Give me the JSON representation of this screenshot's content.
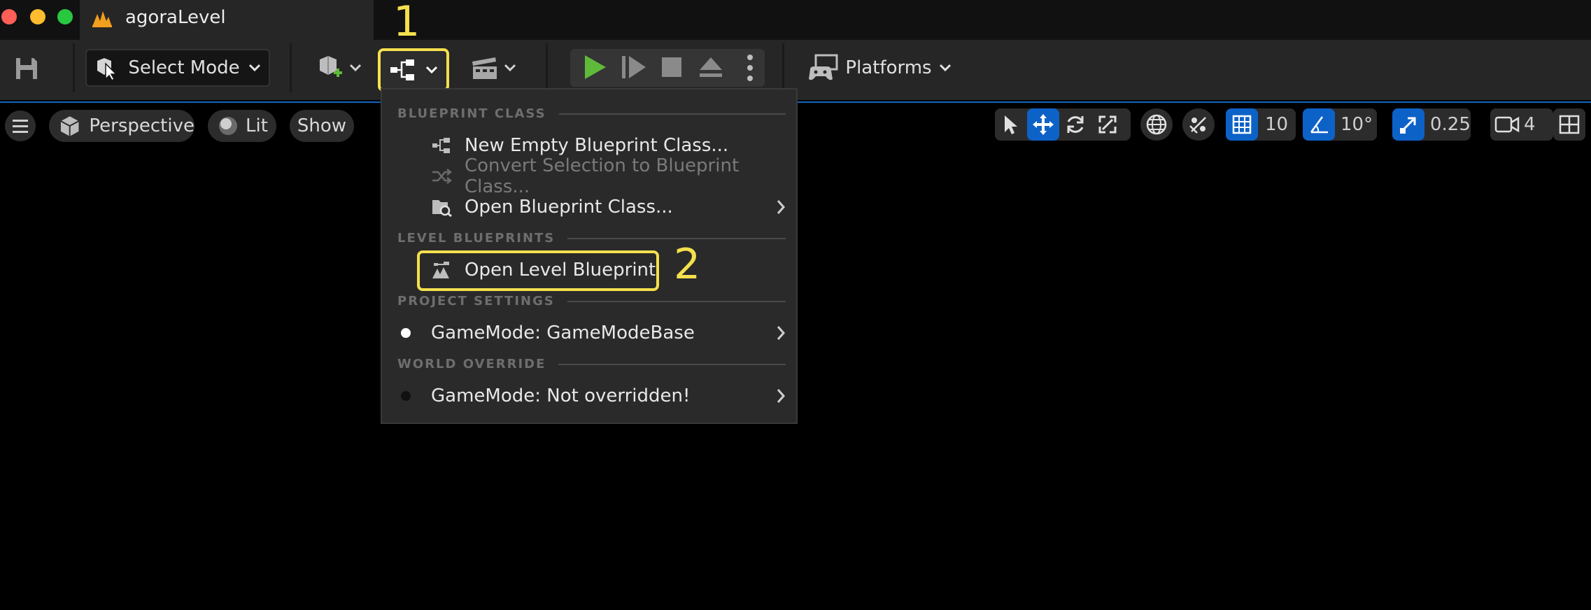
{
  "window": {
    "title": "agoraLevel",
    "traffic_colors": [
      "#ff5f57",
      "#febc2e",
      "#28c840"
    ]
  },
  "toolbar": {
    "select_mode_label": "Select Mode",
    "platforms_label": "Platforms"
  },
  "annotations": {
    "step1": "1",
    "step2": "2"
  },
  "viewport_toolbar": {
    "perspective_label": "Perspective",
    "lit_label": "Lit",
    "show_label": "Show",
    "grid_snap_value": "10",
    "rotation_snap_value": "10°",
    "scale_snap_value": "0.25",
    "camera_speed_value": "4"
  },
  "blueprint_menu": {
    "sections": {
      "blueprint_class": "BLUEPRINT CLASS",
      "level_blueprints": "LEVEL BLUEPRINTS",
      "project_settings": "PROJECT SETTINGS",
      "world_override": "WORLD OVERRIDE"
    },
    "items": {
      "new_empty": "New Empty Blueprint Class...",
      "convert_selection": "Convert Selection to Blueprint Class...",
      "open_class": "Open Blueprint Class...",
      "open_level": "Open Level Blueprint",
      "gamemode_project": "GameMode: GameModeBase",
      "gamemode_world": "GameMode: Not overridden!"
    }
  },
  "colors": {
    "accent_blue": "#0d62c8",
    "highlight_yellow": "#f4e04d",
    "play_green": "#5fba3a",
    "unreal_orange": "#f0a01e"
  }
}
